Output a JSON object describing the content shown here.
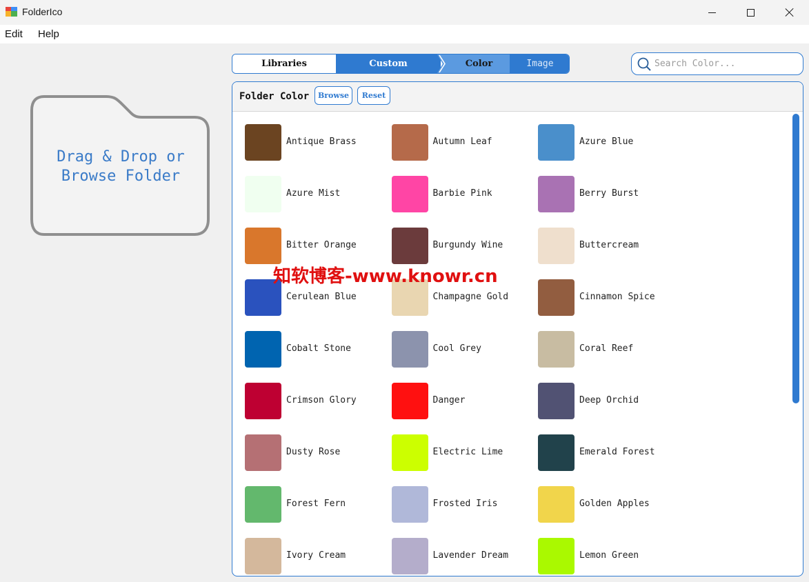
{
  "window": {
    "title": "FolderIco"
  },
  "menu": {
    "edit": "Edit",
    "help": "Help"
  },
  "dropzone": {
    "line1": "Drag & Drop or",
    "line2": "Browse Folder"
  },
  "tabs": {
    "libraries": "Libraries",
    "custom": "Custom",
    "color": "Color",
    "image": "Image"
  },
  "search": {
    "placeholder": "Search Color..."
  },
  "panel": {
    "title": "Folder Color",
    "browse": "Browse",
    "reset": "Reset"
  },
  "colors": [
    {
      "name": "Antique Brass",
      "hex": "#6b4421"
    },
    {
      "name": "Autumn Leaf",
      "hex": "#b56a4a"
    },
    {
      "name": "Azure Blue",
      "hex": "#4a8fcb"
    },
    {
      "name": "Azure Mist",
      "hex": "#f0fff0"
    },
    {
      "name": "Barbie Pink",
      "hex": "#ff45a5"
    },
    {
      "name": "Berry Burst",
      "hex": "#a972b3"
    },
    {
      "name": "Bitter Orange",
      "hex": "#d9772c"
    },
    {
      "name": "Burgundy Wine",
      "hex": "#6b3b3c"
    },
    {
      "name": "Buttercream",
      "hex": "#efdfcd"
    },
    {
      "name": "Cerulean Blue",
      "hex": "#2a52be"
    },
    {
      "name": "Champagne Gold",
      "hex": "#e9d6b1"
    },
    {
      "name": "Cinnamon Spice",
      "hex": "#925d40"
    },
    {
      "name": "Cobalt Stone",
      "hex": "#0064b0"
    },
    {
      "name": "Cool Grey",
      "hex": "#8c93ad"
    },
    {
      "name": "Coral Reef",
      "hex": "#c8bca2"
    },
    {
      "name": "Crimson Glory",
      "hex": "#be0032"
    },
    {
      "name": "Danger",
      "hex": "#ff1010"
    },
    {
      "name": "Deep Orchid",
      "hex": "#515273"
    },
    {
      "name": "Dusty Rose",
      "hex": "#b57074"
    },
    {
      "name": "Electric Lime",
      "hex": "#ccff00"
    },
    {
      "name": "Emerald Forest",
      "hex": "#21424b"
    },
    {
      "name": "Forest Fern",
      "hex": "#63b86d"
    },
    {
      "name": "Frosted Iris",
      "hex": "#b0b8d9"
    },
    {
      "name": "Golden Apples",
      "hex": "#f1d54b"
    },
    {
      "name": "Ivory Cream",
      "hex": "#d4b89c"
    },
    {
      "name": "Lavender Dream",
      "hex": "#b4adcb"
    },
    {
      "name": "Lemon Green",
      "hex": "#aaf900"
    }
  ],
  "watermark": "知软博客-www.knowr.cn",
  "accent": "#2f7ad0"
}
